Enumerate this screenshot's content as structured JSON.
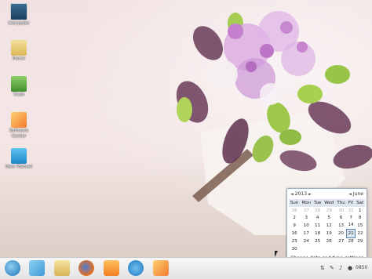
{
  "desktop": {
    "icons": [
      {
        "label": "Computer"
      },
      {
        "label": "Home"
      },
      {
        "label": "Trash"
      },
      {
        "label": "Software Center"
      },
      {
        "label": "User Manual"
      }
    ]
  },
  "calendar": {
    "year": "2013",
    "month": "June",
    "weekdays": [
      "Sun",
      "Mon",
      "Tue",
      "Wed",
      "Thu",
      "Fri",
      "Sat"
    ],
    "weeks": [
      [
        "26",
        "27",
        "28",
        "29",
        "30",
        "31",
        "1"
      ],
      [
        "2",
        "3",
        "4",
        "5",
        "6",
        "7",
        "8"
      ],
      [
        "9",
        "10",
        "11",
        "12",
        "13",
        "14",
        "15"
      ],
      [
        "16",
        "17",
        "18",
        "19",
        "20",
        "21",
        "22"
      ],
      [
        "23",
        "24",
        "25",
        "26",
        "27",
        "28",
        "29"
      ],
      [
        "30",
        "",
        "",
        "",
        "",
        "",
        ""
      ]
    ],
    "today": "21",
    "footer": "Change date and time settings"
  },
  "taskbar": {
    "clock": "0850",
    "apps": [
      "start-menu-icon",
      "software-center-icon",
      "files-icon",
      "firefox-icon",
      "media-player-icon",
      "dictionary-icon",
      "software-center-icon"
    ]
  },
  "colors": {
    "accent": "#5a7fa8",
    "header": "#dfe6ee"
  }
}
